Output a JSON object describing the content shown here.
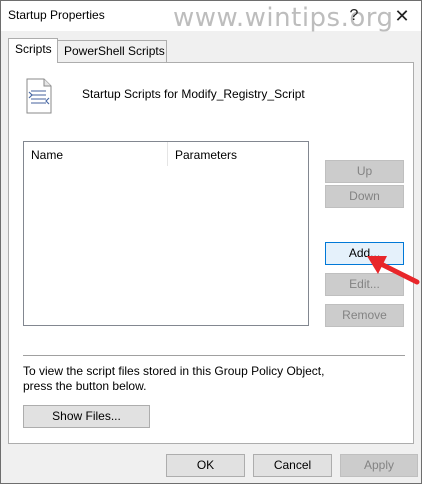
{
  "window": {
    "title": "Startup Properties",
    "watermark": "www.wintips.org",
    "help_glyph": "?",
    "close_glyph": "✕"
  },
  "tabs": [
    {
      "label": "Scripts",
      "active": true
    },
    {
      "label": "PowerShell Scripts",
      "active": false
    }
  ],
  "panel": {
    "heading": "Startup Scripts for Modify_Registry_Script",
    "icon": "script-document-icon",
    "list": {
      "columns": [
        "Name",
        "Parameters"
      ],
      "rows": []
    },
    "buttons": {
      "up": "Up",
      "down": "Down",
      "add": "Add...",
      "edit": "Edit...",
      "remove": "Remove"
    },
    "info_text": "To view the script files stored in this Group Policy Object, press the button below.",
    "show_files": "Show Files..."
  },
  "footer": {
    "ok": "OK",
    "cancel": "Cancel",
    "apply": "Apply"
  },
  "colors": {
    "annotation_arrow": "#e8262a",
    "focus_border": "#0078d7"
  }
}
